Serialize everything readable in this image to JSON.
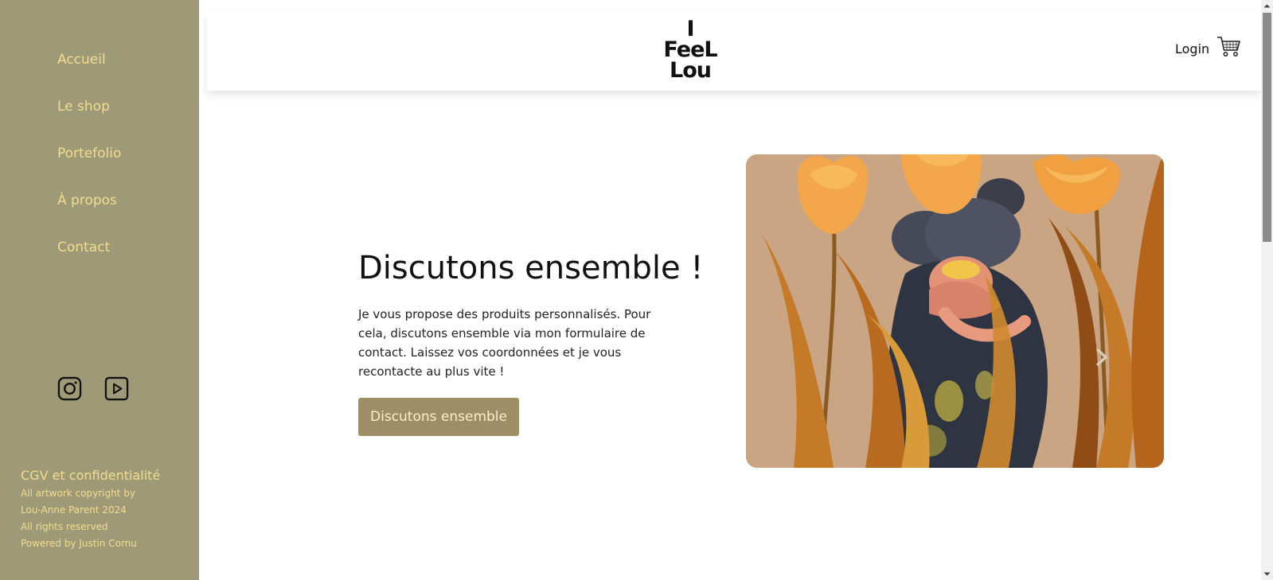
{
  "sidebar": {
    "nav": [
      {
        "label": "Accueil"
      },
      {
        "label": "Le shop"
      },
      {
        "label": "Portefolio"
      },
      {
        "label": "À propos"
      },
      {
        "label": "Contact"
      }
    ],
    "socials": [
      "instagram-icon",
      "youtube-icon"
    ],
    "footer": {
      "link": "CGV et confidentialité",
      "lines": [
        "All artwork copyright by",
        "Lou-Anne Parent 2024",
        "All rights reserved",
        "Powered by Justin Cornu"
      ]
    }
  },
  "header": {
    "logo_lines": [
      "I",
      "FeeL",
      "Lou"
    ],
    "login_label": "Login",
    "cart_icon": "cart-icon"
  },
  "main": {
    "title": "Discutons ensemble !",
    "text": "Je vous propose des produits personnalisés. Pour cela, discutons ensemble via mon formulaire de contact. Laissez vos coordonnées et je vous recontacte au plus vite !",
    "cta_label": "Discutons ensemble",
    "carousel_next_icon": "chevron-right-icon"
  },
  "colors": {
    "sidebar_bg": "#9e9a78",
    "sidebar_text": "#f3dc8e",
    "cta_bg": "#9e8e66",
    "cta_text": "#fbefc5"
  }
}
